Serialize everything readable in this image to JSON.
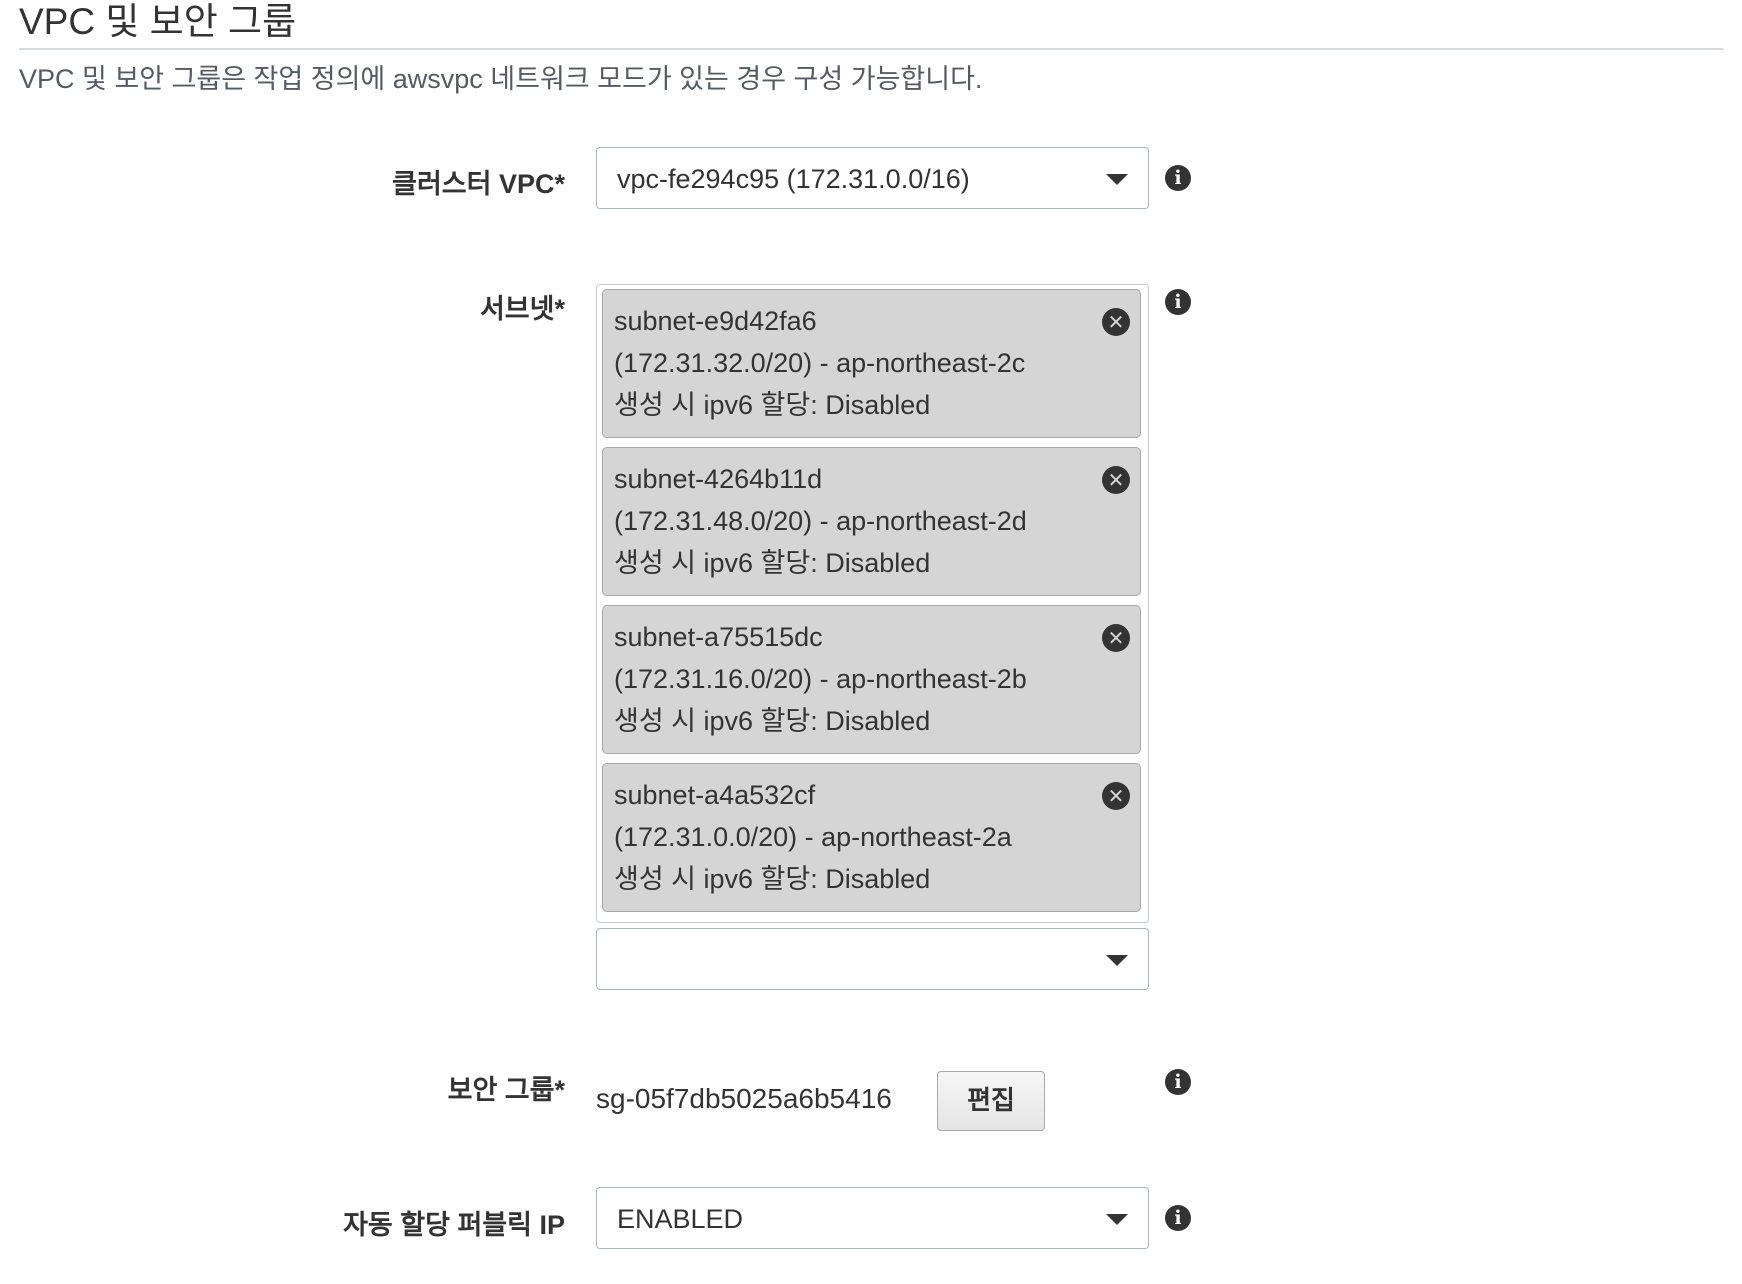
{
  "section": {
    "title": "VPC 및 보안 그룹",
    "description": "VPC 및 보안 그룹은 작업 정의에 awsvpc 네트워크 모드가 있는 경우 구성 가능합니다."
  },
  "cluster_vpc": {
    "label": "클러스터 VPC*",
    "value": "vpc-fe294c95 (172.31.0.0/16)"
  },
  "subnets": {
    "label": "서브넷*",
    "items": [
      {
        "id": "subnet-e9d42fa6",
        "cidr_az": "(172.31.32.0/20) - ap-northeast-2c",
        "ipv6": "생성 시 ipv6 할당: Disabled"
      },
      {
        "id": "subnet-4264b11d",
        "cidr_az": "(172.31.48.0/20) - ap-northeast-2d",
        "ipv6": "생성 시 ipv6 할당: Disabled"
      },
      {
        "id": "subnet-a75515dc",
        "cidr_az": "(172.31.16.0/20) - ap-northeast-2b",
        "ipv6": "생성 시 ipv6 할당: Disabled"
      },
      {
        "id": "subnet-a4a532cf",
        "cidr_az": "(172.31.0.0/20) - ap-northeast-2a",
        "ipv6": "생성 시 ipv6 할당: Disabled"
      }
    ],
    "add_select_value": ""
  },
  "security_group": {
    "label": "보안 그룹*",
    "value": "sg-05f7db5025a6b5416",
    "edit_label": "편집"
  },
  "public_ip": {
    "label": "자동 할당 퍼블릭 IP",
    "value": "ENABLED"
  },
  "icons": {
    "info": "info-icon",
    "remove": "remove-circle-icon",
    "caret": "caret-down-icon"
  }
}
